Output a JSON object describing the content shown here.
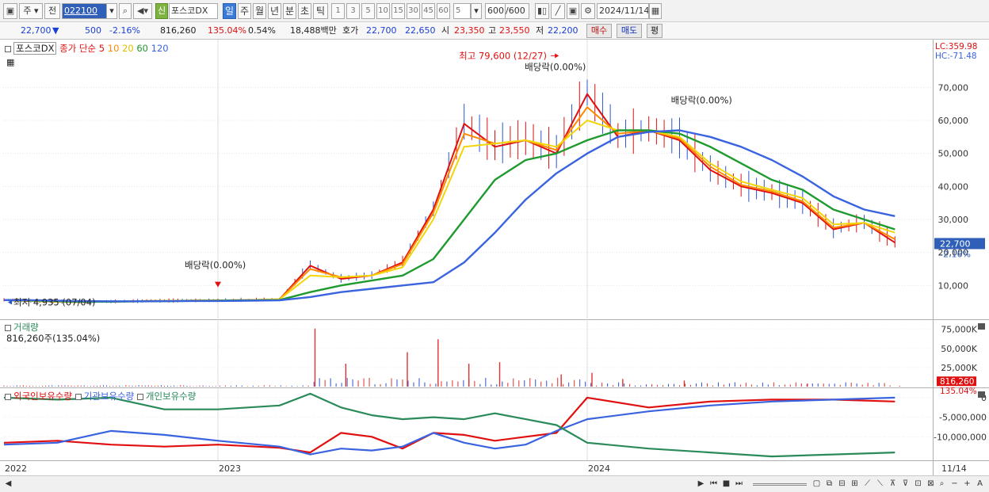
{
  "toolbar": {
    "layout_icon": "▣",
    "mode_label": "주",
    "prev_label": "전",
    "stock_code": "022100",
    "stock_badge": "신",
    "stock_name": "포스코DX",
    "periods": [
      "일",
      "주",
      "월",
      "년",
      "분",
      "초",
      "틱"
    ],
    "active_period": "일",
    "intervals": [
      "1",
      "3",
      "5",
      "10",
      "15",
      "30",
      "45",
      "60"
    ],
    "interval_value": "5",
    "count_value": "600",
    "count_total": "/600",
    "date_value": "2024/11/14"
  },
  "quote": {
    "price": "22,700",
    "arrow": "▼",
    "change": "500",
    "change_pct": "-2.16%",
    "volume": "816,260",
    "volume_ratio": "135.04%",
    "turnover": "0.54%",
    "amount": "18,488백만",
    "bid_label": "호가",
    "ask_price": "22,700",
    "bid_price": "22,650",
    "open_label": "시",
    "open_price": "23,350",
    "high_label": "고",
    "high_price": "23,550",
    "low_label": "저",
    "low_price": "22,200",
    "buy_label": "매수",
    "sell_label": "매도",
    "eval_label": "평"
  },
  "colors": {
    "candle": "#e01010",
    "ma5": "#e01010",
    "ma10": "#ff8a00",
    "ma20": "#f2d60a",
    "ma60": "#1f9a2e",
    "ma120": "#3a63e0",
    "foreign": "#e01010",
    "institution": "#3a63e0",
    "individual": "#2a8a5a"
  },
  "legend": {
    "name": "포스코DX",
    "ma_title": "종가 단순",
    "ma_periods": [
      "5",
      "10",
      "20",
      "60",
      "120"
    ]
  },
  "top_right": {
    "lc": "LC:359.98",
    "hc": "HC:-71.48"
  },
  "annotations": {
    "high": "최고 79,600 (12/27)",
    "low": "최저 4,935 (07/04)",
    "dividend": "배당락(0.00%)"
  },
  "price_label": "22,700",
  "price_pct_label": "-2.16%",
  "volume_panel": {
    "title": "거래량",
    "current": "816,260주(135.04%)",
    "label_value": "816,260",
    "label_pct": "135.04%"
  },
  "holding_panel": {
    "series": [
      "외국인보유수량",
      "기관보유수량",
      "개인보유수량"
    ]
  },
  "x_axis": {
    "labels": [
      "2022",
      "2023",
      "2024"
    ],
    "right_label": "11/14"
  },
  "chart_data": [
    {
      "type": "line",
      "title": "",
      "x": [
        "2022-01",
        "2022-03",
        "2022-05",
        "2022-07",
        "2022-09",
        "2022-11",
        "2023-01",
        "2023-02",
        "2023-03",
        "2023-04",
        "2023-05",
        "2023-06",
        "2023-07",
        "2023-08",
        "2023-09",
        "2023-10",
        "2023-11",
        "2023-12",
        "2024-01",
        "2024-02",
        "2024-03",
        "2024-04",
        "2024-05",
        "2024-06",
        "2024-07",
        "2024-08",
        "2024-09",
        "2024-10",
        "2024-11"
      ],
      "series": [
        {
          "name": "5",
          "values": [
            5600,
            5200,
            5000,
            5100,
            5300,
            5400,
            5500,
            5600,
            5800,
            16000,
            12000,
            13000,
            17000,
            33000,
            59000,
            52000,
            54000,
            50000,
            68000,
            55000,
            57000,
            54000,
            45000,
            40000,
            38000,
            35000,
            27000,
            29000,
            23000
          ]
        },
        {
          "name": "10",
          "values": [
            5600,
            5200,
            5000,
            5100,
            5300,
            5400,
            5500,
            5600,
            5800,
            15000,
            12500,
            13000,
            16500,
            32000,
            56000,
            53000,
            54000,
            51000,
            64000,
            56000,
            57000,
            54500,
            46000,
            40500,
            38500,
            35500,
            27500,
            29000,
            24000
          ]
        },
        {
          "name": "20",
          "values": [
            5600,
            5200,
            5000,
            5100,
            5300,
            5400,
            5500,
            5600,
            5800,
            13000,
            12500,
            13000,
            15500,
            30000,
            52000,
            53000,
            54000,
            52000,
            60000,
            57000,
            57000,
            55000,
            47000,
            41500,
            39000,
            36500,
            28500,
            29000,
            26000
          ]
        },
        {
          "name": "60",
          "values": [
            5600,
            5400,
            5100,
            5100,
            5200,
            5300,
            5400,
            5500,
            5600,
            8000,
            10000,
            11500,
            13000,
            18000,
            30000,
            42000,
            48000,
            50000,
            54000,
            57000,
            57000,
            56000,
            52000,
            47000,
            42000,
            39000,
            33000,
            30000,
            27000
          ]
        },
        {
          "name": "120",
          "values": [
            5600,
            5500,
            5300,
            5200,
            5200,
            5300,
            5300,
            5400,
            5500,
            6500,
            8000,
            9000,
            10000,
            11000,
            17000,
            26000,
            36000,
            44000,
            50000,
            55000,
            56500,
            57000,
            55000,
            52000,
            48000,
            43000,
            37000,
            33000,
            31000
          ]
        }
      ],
      "ylabel": "",
      "yticks": [
        10000,
        20000,
        30000,
        40000,
        50000,
        60000,
        70000
      ],
      "ytick_labels": [
        "10,000",
        "20,000",
        "30,000",
        "40,000",
        "50,000",
        "60,000",
        "70,000"
      ],
      "ylim": [
        0,
        84000
      ],
      "grid": true
    },
    {
      "type": "bar",
      "title": "거래량",
      "x": [
        "2023-04",
        "2023-05",
        "2023-07",
        "2023-08",
        "2023-09",
        "2023-10",
        "2023-12",
        "2024-01",
        "2024-02",
        "2024-04",
        "2024-08",
        "2024-11"
      ],
      "values": [
        76000000,
        30000000,
        45000000,
        62000000,
        30000000,
        32000000,
        16000000,
        18000000,
        10000000,
        8000000,
        4000000,
        816260
      ],
      "yticks": [
        25000000,
        50000000,
        75000000
      ],
      "ytick_labels": [
        "25,000K",
        "50,000K",
        "75,000K"
      ],
      "ylim": [
        0,
        85000000
      ]
    },
    {
      "type": "line",
      "title": "",
      "x": [
        "2022-01",
        "2022-04",
        "2022-07",
        "2022-10",
        "2023-01",
        "2023-03",
        "2023-04",
        "2023-05",
        "2023-06",
        "2023-07",
        "2023-08",
        "2023-09",
        "2023-10",
        "2023-11",
        "2023-12",
        "2024-01",
        "2024-03",
        "2024-05",
        "2024-07",
        "2024-09",
        "2024-11"
      ],
      "series": [
        {
          "name": "외국인보유수량",
          "values": [
            -11500000,
            -11000000,
            -12000000,
            -12500000,
            -12000000,
            -12800000,
            -14000000,
            -9000000,
            -10000000,
            -13000000,
            -9000000,
            -9500000,
            -11000000,
            -10000000,
            -9000000,
            0,
            -2500000,
            -1000000,
            -500000,
            -500000,
            -1000000
          ]
        },
        {
          "name": "기관보유수량",
          "values": [
            -12000000,
            -11500000,
            -8500000,
            -9500000,
            -11000000,
            -12500000,
            -14500000,
            -13000000,
            -13500000,
            -12500000,
            -9000000,
            -11500000,
            -13000000,
            -12000000,
            -8500000,
            -5500000,
            -3500000,
            -2000000,
            -1000000,
            -500000,
            0
          ]
        },
        {
          "name": "개인보유수량",
          "values": [
            0,
            -500000,
            0,
            -3000000,
            -3000000,
            -2000000,
            1000000,
            -2500000,
            -4500000,
            -5500000,
            -5000000,
            -5500000,
            -4000000,
            -5500000,
            -7000000,
            -11500000,
            -13000000,
            -14000000,
            -15000000,
            -14500000,
            -14000000
          ]
        }
      ],
      "yticks": [
        0,
        -5000000,
        -10000000
      ],
      "ytick_labels": [
        "0",
        "-5,000,000",
        "-10,000,000"
      ],
      "ylim": [
        -16000000,
        2000000
      ]
    }
  ]
}
